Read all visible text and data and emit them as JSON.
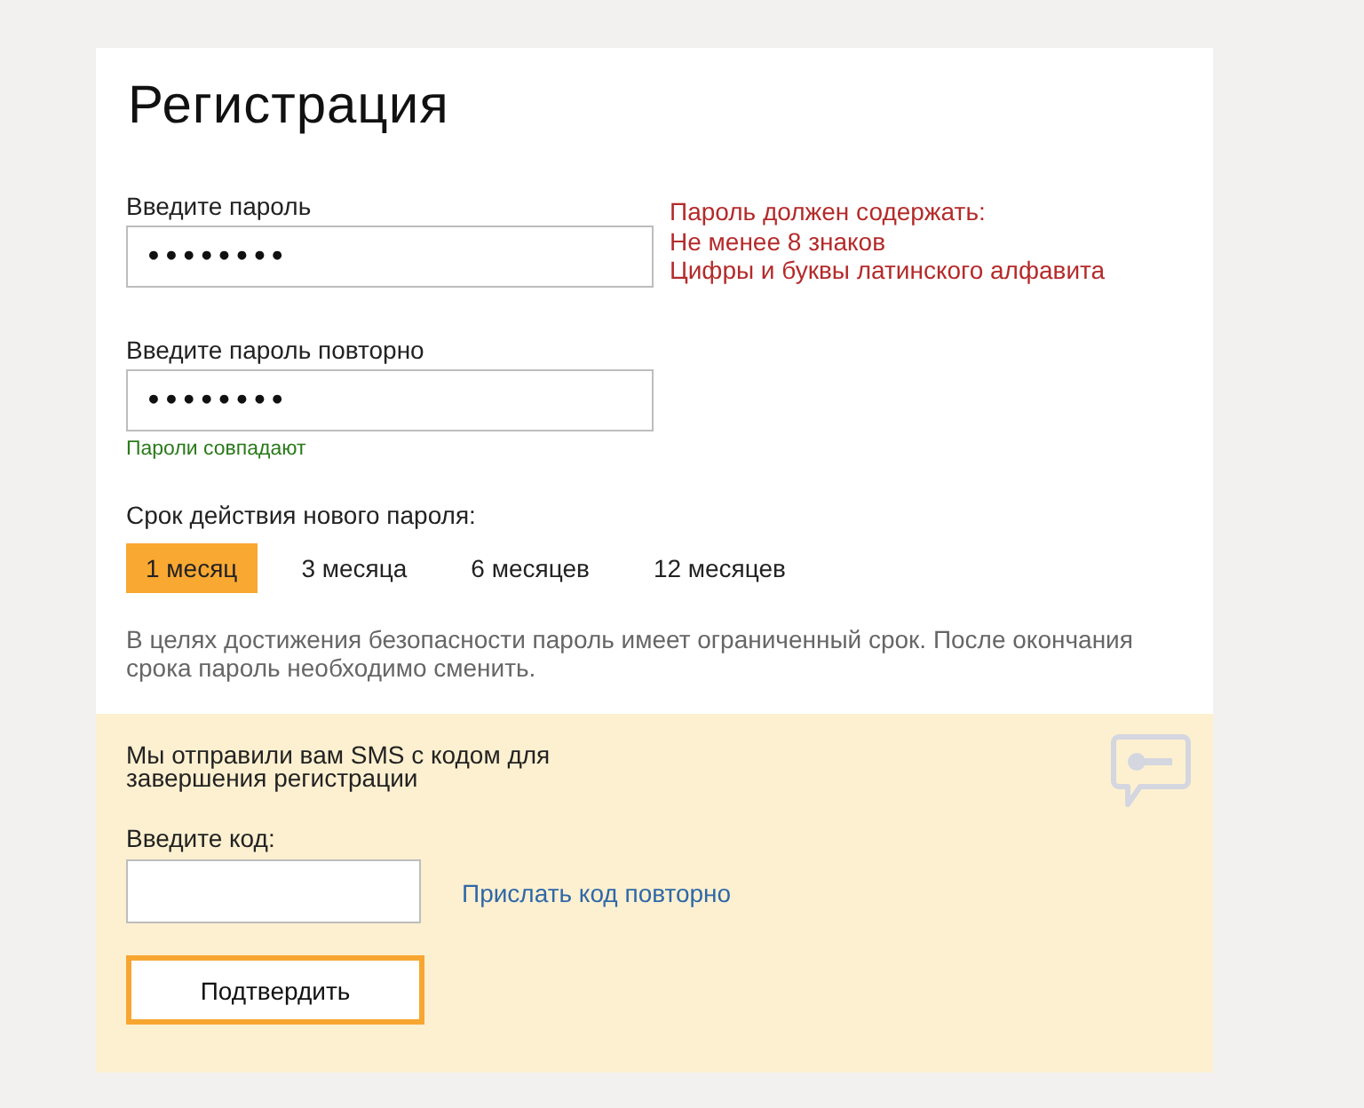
{
  "title": "Регистрация",
  "password": {
    "label": "Введите пароль",
    "value": "••••••••"
  },
  "requirements": [
    "Пароль должен содержать:",
    "Не менее 8 знаков",
    "Цифры и буквы латинского алфавита"
  ],
  "password_repeat": {
    "label": "Введите пароль повторно",
    "value": "••••••••",
    "hint": "Пароли совпадают"
  },
  "validity": {
    "label": "Срок действия нового пароля:",
    "options": [
      {
        "label": "1 месяц",
        "selected": true
      },
      {
        "label": "3 месяца",
        "selected": false
      },
      {
        "label": "6 месяцев",
        "selected": false
      },
      {
        "label": "12 месяцев",
        "selected": false
      }
    ]
  },
  "validity_note": "В целях достижения безопасности пароль имеет ограниченный срок. После окончания срока пароль необходимо сменить.",
  "sms": {
    "message": "Мы отправили вам SMS с кодом для завершения регистрации",
    "code_label": "Введите код:",
    "resend_link": "Прислать код повторно",
    "confirm_button": "Подтвердить"
  }
}
